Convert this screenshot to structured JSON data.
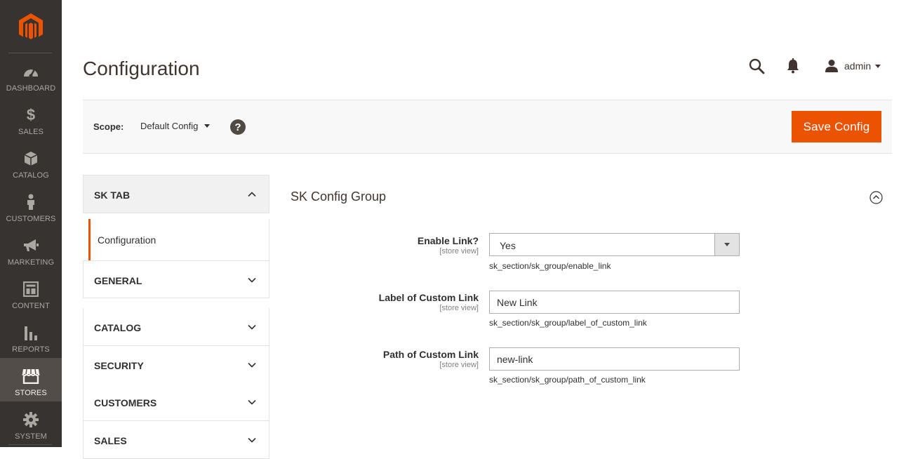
{
  "colors": {
    "nav_bg": "#373330",
    "nav_active": "#524d49",
    "accent": "#eb5202",
    "logo": "#eb5202"
  },
  "nav": {
    "items": [
      {
        "label": "DASHBOARD",
        "icon": "dashboard-icon"
      },
      {
        "label": "SALES",
        "icon": "dollar-icon"
      },
      {
        "label": "CATALOG",
        "icon": "box-icon"
      },
      {
        "label": "CUSTOMERS",
        "icon": "person-icon"
      },
      {
        "label": "MARKETING",
        "icon": "megaphone-icon"
      },
      {
        "label": "CONTENT",
        "icon": "layout-icon"
      },
      {
        "label": "REPORTS",
        "icon": "bar-chart-icon"
      },
      {
        "label": "STORES",
        "icon": "storefront-icon",
        "active": true
      },
      {
        "label": "SYSTEM",
        "icon": "gear-icon"
      }
    ]
  },
  "header": {
    "title": "Configuration",
    "user": "admin"
  },
  "scope": {
    "label": "Scope:",
    "value": "Default Config",
    "help": "?",
    "save_label": "Save Config"
  },
  "tabs": {
    "section": "SK TAB",
    "sub_item": "Configuration",
    "rows": [
      "GENERAL",
      "CATALOG",
      "SECURITY",
      "CUSTOMERS",
      "SALES"
    ]
  },
  "group": {
    "title": "SK Config Group",
    "fields": [
      {
        "label": "Enable Link?",
        "scope": "[store view]",
        "type": "select",
        "value": "Yes",
        "note": "sk_section/sk_group/enable_link"
      },
      {
        "label": "Label of Custom Link",
        "scope": "[store view]",
        "type": "text",
        "value": "New Link",
        "note": "sk_section/sk_group/label_of_custom_link"
      },
      {
        "label": "Path of Custom Link",
        "scope": "[store view]",
        "type": "text",
        "value": "new-link",
        "note": "sk_section/sk_group/path_of_custom_link"
      }
    ]
  }
}
